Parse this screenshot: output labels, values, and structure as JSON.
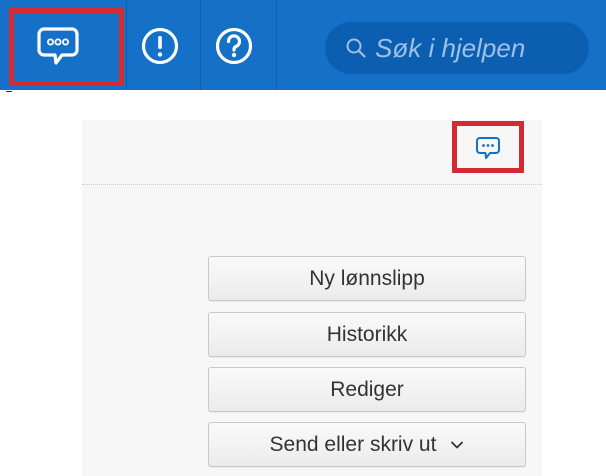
{
  "topbar": {
    "chat_icon": "chat-bubble-icon",
    "alert_icon": "exclamation-circle-icon",
    "help_icon": "question-circle-icon",
    "search_placeholder": "Søk i hjelpen",
    "bg_color": "#1570c7"
  },
  "panel": {
    "chat_icon": "chat-bubble-icon",
    "buttons": [
      {
        "label": "Ny lønnslipp"
      },
      {
        "label": "Historikk"
      },
      {
        "label": "Rediger"
      },
      {
        "label": "Send eller skriv ut",
        "icon": "chevron-down-icon"
      }
    ]
  },
  "colors": {
    "highlight": "#d42a32",
    "accent": "#1570c7"
  }
}
